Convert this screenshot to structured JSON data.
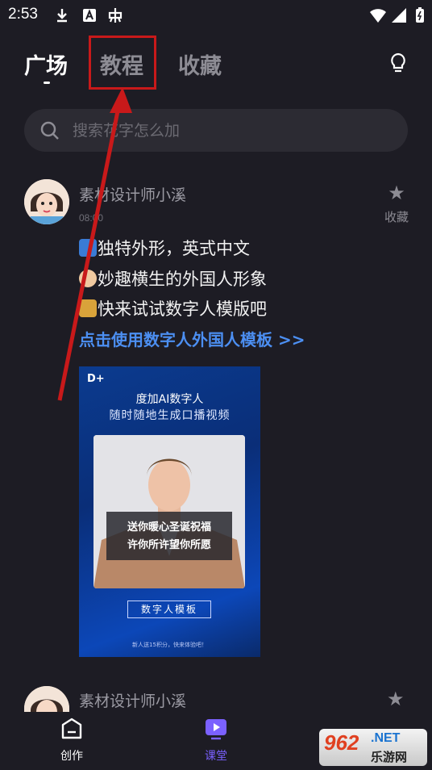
{
  "status_bar": {
    "time": "2:53"
  },
  "tabs": [
    {
      "label": "广场",
      "active": true
    },
    {
      "label": "教程",
      "active": false
    },
    {
      "label": "收藏",
      "active": false
    }
  ],
  "search": {
    "placeholder": "搜索花字怎么加"
  },
  "posts": [
    {
      "author": "素材设计师小溪",
      "time": "08:00",
      "favorite_label": "收藏",
      "lines": [
        "独特外形，英式中文",
        "妙趣横生的外国人形象",
        "快来试试数字人模版吧"
      ],
      "link": "点击使用数字人外国人模板 >>",
      "thumbnail": {
        "title": "度加AI数字人",
        "subtitle": "随时随地生成口播视频",
        "caption_line1": "送你暖心圣诞祝福",
        "caption_line2": "许你所许望你所愿",
        "template_label": "数字人模板",
        "footer": "新人送15积分，快来体验吧！"
      }
    },
    {
      "author": "素材设计师小溪"
    }
  ],
  "bottom_nav": [
    {
      "label": "创作",
      "icon": "create-icon",
      "active": false
    },
    {
      "label": "课堂",
      "icon": "play-icon",
      "active": true
    }
  ],
  "watermark": {
    "brand": "962",
    "domain": ".NET",
    "text": "乐游网"
  },
  "colors": {
    "background": "#1d1c24",
    "accent": "#7b61ff",
    "link": "#4c8ff2",
    "annotation": "#c8191a"
  }
}
